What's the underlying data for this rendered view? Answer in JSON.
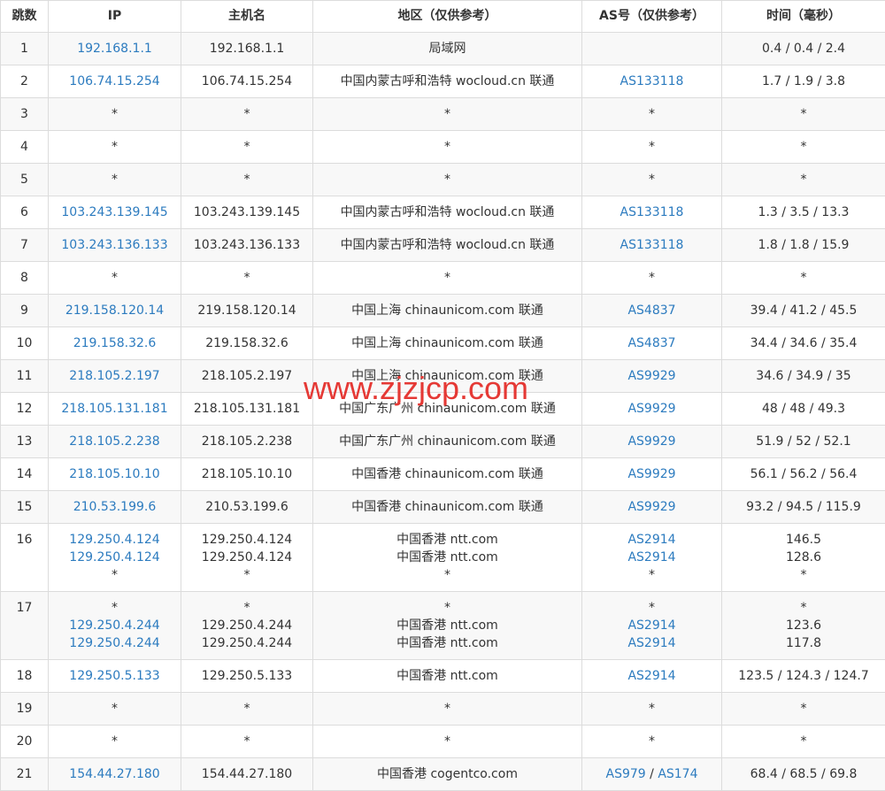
{
  "headers": [
    "跳数",
    "IP",
    "主机名",
    "地区（仅供参考）",
    "AS号（仅供参考）",
    "时间（毫秒）"
  ],
  "rows": [
    {
      "hop": "1",
      "ip": [
        "192.168.1.1"
      ],
      "host": [
        "192.168.1.1"
      ],
      "region": [
        "局域网"
      ],
      "as": [
        []
      ],
      "time": [
        "0.4 / 0.4 / 2.4"
      ]
    },
    {
      "hop": "2",
      "ip": [
        "106.74.15.254"
      ],
      "host": [
        "106.74.15.254"
      ],
      "region": [
        "中国内蒙古呼和浩特 wocloud.cn 联通"
      ],
      "as": [
        [
          "AS133118"
        ]
      ],
      "time": [
        "1.7 / 1.9 / 3.8"
      ]
    },
    {
      "hop": "3",
      "ip": [
        "*"
      ],
      "host": [
        "*"
      ],
      "region": [
        "*"
      ],
      "as": [
        [
          "*"
        ]
      ],
      "time": [
        "*"
      ]
    },
    {
      "hop": "4",
      "ip": [
        "*"
      ],
      "host": [
        "*"
      ],
      "region": [
        "*"
      ],
      "as": [
        [
          "*"
        ]
      ],
      "time": [
        "*"
      ]
    },
    {
      "hop": "5",
      "ip": [
        "*"
      ],
      "host": [
        "*"
      ],
      "region": [
        "*"
      ],
      "as": [
        [
          "*"
        ]
      ],
      "time": [
        "*"
      ]
    },
    {
      "hop": "6",
      "ip": [
        "103.243.139.145"
      ],
      "host": [
        "103.243.139.145"
      ],
      "region": [
        "中国内蒙古呼和浩特 wocloud.cn 联通"
      ],
      "as": [
        [
          "AS133118"
        ]
      ],
      "time": [
        "1.3 / 3.5 / 13.3"
      ]
    },
    {
      "hop": "7",
      "ip": [
        "103.243.136.133"
      ],
      "host": [
        "103.243.136.133"
      ],
      "region": [
        "中国内蒙古呼和浩特 wocloud.cn 联通"
      ],
      "as": [
        [
          "AS133118"
        ]
      ],
      "time": [
        "1.8 / 1.8 / 15.9"
      ]
    },
    {
      "hop": "8",
      "ip": [
        "*"
      ],
      "host": [
        "*"
      ],
      "region": [
        "*"
      ],
      "as": [
        [
          "*"
        ]
      ],
      "time": [
        "*"
      ]
    },
    {
      "hop": "9",
      "ip": [
        "219.158.120.14"
      ],
      "host": [
        "219.158.120.14"
      ],
      "region": [
        "中国上海 chinaunicom.com 联通"
      ],
      "as": [
        [
          "AS4837"
        ]
      ],
      "time": [
        "39.4 / 41.2 / 45.5"
      ]
    },
    {
      "hop": "10",
      "ip": [
        "219.158.32.6"
      ],
      "host": [
        "219.158.32.6"
      ],
      "region": [
        "中国上海 chinaunicom.com 联通"
      ],
      "as": [
        [
          "AS4837"
        ]
      ],
      "time": [
        "34.4 / 34.6 / 35.4"
      ]
    },
    {
      "hop": "11",
      "ip": [
        "218.105.2.197"
      ],
      "host": [
        "218.105.2.197"
      ],
      "region": [
        "中国上海 chinaunicom.com 联通"
      ],
      "as": [
        [
          "AS9929"
        ]
      ],
      "time": [
        "34.6 / 34.9 / 35"
      ]
    },
    {
      "hop": "12",
      "ip": [
        "218.105.131.181"
      ],
      "host": [
        "218.105.131.181"
      ],
      "region": [
        "中国广东广州 chinaunicom.com 联通"
      ],
      "as": [
        [
          "AS9929"
        ]
      ],
      "time": [
        "48 / 48 / 49.3"
      ]
    },
    {
      "hop": "13",
      "ip": [
        "218.105.2.238"
      ],
      "host": [
        "218.105.2.238"
      ],
      "region": [
        "中国广东广州 chinaunicom.com 联通"
      ],
      "as": [
        [
          "AS9929"
        ]
      ],
      "time": [
        "51.9 / 52 / 52.1"
      ]
    },
    {
      "hop": "14",
      "ip": [
        "218.105.10.10"
      ],
      "host": [
        "218.105.10.10"
      ],
      "region": [
        "中国香港 chinaunicom.com 联通"
      ],
      "as": [
        [
          "AS9929"
        ]
      ],
      "time": [
        "56.1 / 56.2 / 56.4"
      ]
    },
    {
      "hop": "15",
      "ip": [
        "210.53.199.6"
      ],
      "host": [
        "210.53.199.6"
      ],
      "region": [
        "中国香港 chinaunicom.com 联通"
      ],
      "as": [
        [
          "AS9929"
        ]
      ],
      "time": [
        "93.2 / 94.5 / 115.9"
      ]
    },
    {
      "hop": "16",
      "ip": [
        "129.250.4.124",
        "129.250.4.124",
        "*"
      ],
      "host": [
        "129.250.4.124",
        "129.250.4.124",
        "*"
      ],
      "region": [
        "中国香港 ntt.com",
        "中国香港 ntt.com",
        "*"
      ],
      "as": [
        [
          "AS2914"
        ],
        [
          "AS2914"
        ],
        [
          "*"
        ]
      ],
      "time": [
        "146.5",
        "128.6",
        "*"
      ]
    },
    {
      "hop": "17",
      "ip": [
        "*",
        "129.250.4.244",
        "129.250.4.244"
      ],
      "host": [
        "*",
        "129.250.4.244",
        "129.250.4.244"
      ],
      "region": [
        "*",
        "中国香港 ntt.com",
        "中国香港 ntt.com"
      ],
      "as": [
        [
          "*"
        ],
        [
          "AS2914"
        ],
        [
          "AS2914"
        ]
      ],
      "time": [
        "*",
        "123.6",
        "117.8"
      ]
    },
    {
      "hop": "18",
      "ip": [
        "129.250.5.133"
      ],
      "host": [
        "129.250.5.133"
      ],
      "region": [
        "中国香港 ntt.com"
      ],
      "as": [
        [
          "AS2914"
        ]
      ],
      "time": [
        "123.5 / 124.3 / 124.7"
      ]
    },
    {
      "hop": "19",
      "ip": [
        "*"
      ],
      "host": [
        "*"
      ],
      "region": [
        "*"
      ],
      "as": [
        [
          "*"
        ]
      ],
      "time": [
        "*"
      ]
    },
    {
      "hop": "20",
      "ip": [
        "*"
      ],
      "host": [
        "*"
      ],
      "region": [
        "*"
      ],
      "as": [
        [
          "*"
        ]
      ],
      "time": [
        "*"
      ]
    },
    {
      "hop": "21",
      "ip": [
        "154.44.27.180"
      ],
      "host": [
        "154.44.27.180"
      ],
      "region": [
        "中国香港 cogentco.com"
      ],
      "as": [
        [
          "AS979",
          "AS174"
        ]
      ],
      "time": [
        "68.4 / 68.5 / 69.8"
      ]
    }
  ],
  "as_separator": " / ",
  "watermark": "www.zjzjcp.com",
  "colors": {
    "link": "#2c7bbf",
    "text": "#333333",
    "border": "#dcdcdc",
    "alt_row": "#f8f8f8",
    "watermark": "#e53935"
  }
}
